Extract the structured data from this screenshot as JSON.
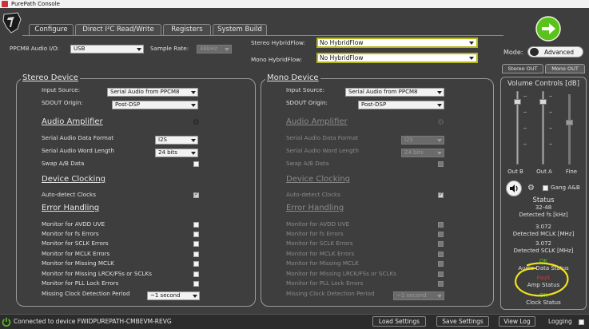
{
  "window": {
    "title": "PurePath Console"
  },
  "tabs": [
    {
      "label": "Configure",
      "active": true
    },
    {
      "label": "Direct I²C Read/Write",
      "active": false
    },
    {
      "label": "Registers",
      "active": false
    },
    {
      "label": "System Build",
      "active": false
    }
  ],
  "top": {
    "audio_io_label": "PPCM8 Audio I/O:",
    "audio_io_value": "USB",
    "sample_rate_label": "Sample Rate:",
    "sample_rate_value": "48kHz",
    "stereo_hybridflow_label": "Stereo HybridFlow:",
    "stereo_hybridflow_value": "No HybridFlow",
    "mono_hybridflow_label": "Mono HybridFlow:",
    "mono_hybridflow_value": "No HybridFlow"
  },
  "stereo": {
    "title": "Stereo Device",
    "input_source_label": "Input Source:",
    "input_source_value": "Serial Audio from PPCM8",
    "sdout_label": "SDOUT Origin:",
    "sdout_value": "Post-DSP",
    "amp_section": "Audio Amplifier",
    "format_label": "Serial Audio Data Format",
    "format_value": "I2S",
    "word_label": "Serial Audio Word Length",
    "word_value": "24 bits",
    "swap_label": "Swap A/B Data",
    "clocking_section": "Device Clocking",
    "autodetect_label": "Auto-detect Clocks",
    "error_section": "Error Handling",
    "monitors": [
      "Monitor for AVDD UVE",
      "Monitor for fs Errors",
      "Monitor for SCLK Errors",
      "Monitor for MCLK Errors",
      "Monitor for Missing MCLK",
      "Monitor for Missing LRCK/FSs or SCLKs",
      "Monitor for PLL Lock Errors"
    ],
    "missing_label": "Missing Clock Detection Period",
    "missing_value": "~1 second"
  },
  "mono": {
    "title": "Mono Device",
    "input_source_label": "Input Source:",
    "input_source_value": "Serial Audio from PPCM8",
    "sdout_label": "SDOUT Origin:",
    "sdout_value": "Post-DSP",
    "amp_section": "Audio Amplifier",
    "format_label": "Serial Audio Data Format",
    "format_value": "I2S",
    "word_label": "Serial Audio Word Length",
    "word_value": "24 bits",
    "swap_label": "Swap A/B Data",
    "clocking_section": "Device Clocking",
    "autodetect_label": "Auto-detect Clocks",
    "error_section": "Error Handling",
    "monitors": [
      "Monitor for AVDD UVE",
      "Monitor for fs Errors",
      "Monitor for SCLK Errors",
      "Monitor for MCLK Errors",
      "Monitor for Missing MCLK",
      "Monitor for Missing LRCK/FSs or SCLKs",
      "Monitor for PLL Lock Errors"
    ],
    "missing_label": "Missing Clock Detection Period",
    "missing_value": "~1 second"
  },
  "right": {
    "mode_label": "Mode:",
    "mode_value": "Advanced",
    "tab_stereo": "Stereo OUT",
    "tab_mono": "Mono OUT",
    "volume_title": "Volume Controls [dB]",
    "slider_labels": [
      "Out B",
      "Out A",
      "Fine"
    ],
    "gang_label": "Gang A&B",
    "status_title": "Status",
    "fs_value": "32-48",
    "fs_label": "Detected fs [kHz]",
    "mclk_value": "3.072",
    "mclk_label": "Detected MCLK [MHz]",
    "sclk_value": "3.072",
    "sclk_label": "Detected SCLK [MHz]",
    "audio_status_value": "OK",
    "audio_status_label": "Audio Data Status",
    "amp_status_value": "Fault",
    "amp_status_label": "Amp Status",
    "clock_status_value": "OK",
    "clock_status_label": "Clock Status"
  },
  "statusbar": {
    "connection_text": "Connected to device FWIDPUREPATH-CMBEVM-REVG",
    "load_label": "Load Settings",
    "save_label": "Save Settings",
    "viewlog_label": "View Log",
    "logging_label": "Logging"
  },
  "colors": {
    "background": "#3e3e3e",
    "accent_green": "#5ac21a",
    "hybridflow_border": "#b6b616",
    "status_ok": "#5ac21a",
    "status_fault": "#e03030",
    "annotation_yellow": "#f2e21a"
  }
}
